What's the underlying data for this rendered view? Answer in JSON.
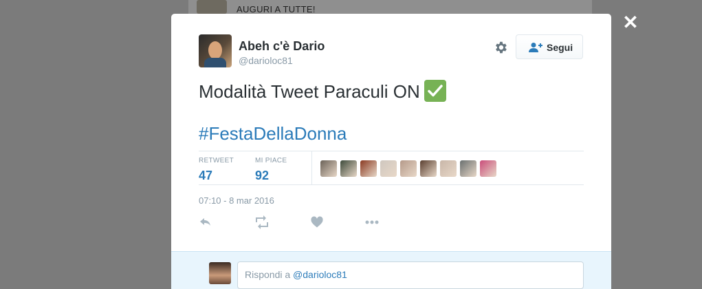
{
  "background": {
    "timeline_text": "AUGURI A TUTTE!"
  },
  "tweet": {
    "author_name": "Abeh c'è Dario",
    "author_handle": "@darioloc81",
    "text": "Modalità Tweet Paraculi ON",
    "emoji_icon": "white-heavy-check-mark-icon",
    "hashtag": "#FestaDellaDonna",
    "timestamp": "07:10 - 8 mar 2016"
  },
  "follow_button": {
    "label": "Segui"
  },
  "stats": {
    "retweet_label": "RETWEET",
    "retweet_count": "47",
    "likes_label": "MI PIACE",
    "likes_count": "92",
    "liker_avatar_colors": [
      "#6b6258",
      "#3d4a3a",
      "#8a3a22",
      "#cfc7bf",
      "#b59a8a",
      "#5a3f30",
      "#c8b6a8",
      "#6a7070",
      "#c94d7a"
    ]
  },
  "reply": {
    "prefix": "Rispondi a ",
    "mention": "@darioloc81"
  },
  "colors": {
    "link": "#2b7bb9",
    "accent": "#77b255"
  }
}
